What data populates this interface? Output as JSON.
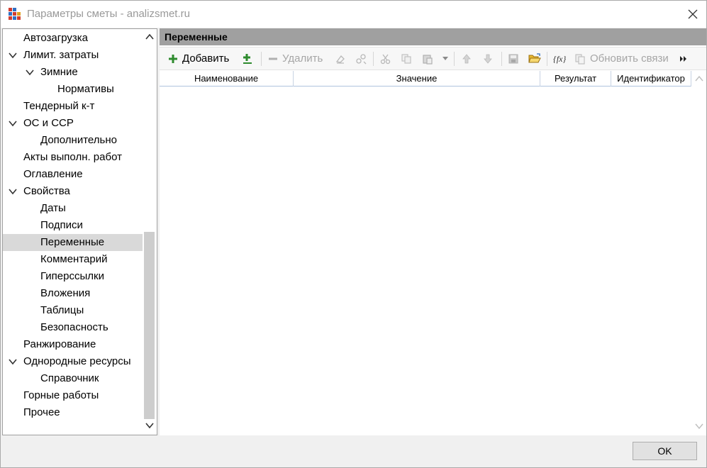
{
  "window": {
    "title": "Параметры сметы - analizsmet.ru",
    "close_icon": "close-icon",
    "app_icon": "app-grid-icon"
  },
  "tree": {
    "items": [
      {
        "label": "Автозагрузка",
        "level": 0,
        "expanded": null
      },
      {
        "label": "Лимит. затраты",
        "level": 0,
        "expanded": true
      },
      {
        "label": "Зимние",
        "level": 1,
        "expanded": true
      },
      {
        "label": "Нормативы",
        "level": 2,
        "expanded": null
      },
      {
        "label": "Тендерный к-т",
        "level": 0,
        "expanded": null
      },
      {
        "label": "ОС и ССР",
        "level": 0,
        "expanded": true
      },
      {
        "label": "Дополнительно",
        "level": 1,
        "expanded": null
      },
      {
        "label": "Акты выполн. работ",
        "level": 0,
        "expanded": null
      },
      {
        "label": "Оглавление",
        "level": 0,
        "expanded": null
      },
      {
        "label": "Свойства",
        "level": 0,
        "expanded": true
      },
      {
        "label": "Даты",
        "level": 1,
        "expanded": null
      },
      {
        "label": "Подписи",
        "level": 1,
        "expanded": null
      },
      {
        "label": "Переменные",
        "level": 1,
        "expanded": null,
        "selected": true
      },
      {
        "label": "Комментарий",
        "level": 1,
        "expanded": null
      },
      {
        "label": "Гиперссылки",
        "level": 1,
        "expanded": null
      },
      {
        "label": "Вложения",
        "level": 1,
        "expanded": null
      },
      {
        "label": "Таблицы",
        "level": 1,
        "expanded": null
      },
      {
        "label": "Безопасность",
        "level": 1,
        "expanded": null
      },
      {
        "label": "Ранжирование",
        "level": 0,
        "expanded": null
      },
      {
        "label": "Однородные ресурсы",
        "level": 0,
        "expanded": true
      },
      {
        "label": "Справочник",
        "level": 1,
        "expanded": null
      },
      {
        "label": "Горные работы",
        "level": 0,
        "expanded": null
      },
      {
        "label": "Прочее",
        "level": 0,
        "expanded": null
      }
    ]
  },
  "panel": {
    "title": "Переменные"
  },
  "toolbar": {
    "add_label": "Добавить",
    "delete_label": "Удалить",
    "refresh_label": "Обновить связи"
  },
  "grid": {
    "columns": [
      "Наименование",
      "Значение",
      "Результат",
      "Идентификатор"
    ],
    "rows": []
  },
  "footer": {
    "ok_label": "OK"
  },
  "colors": {
    "header_bar": "#a0a0a0",
    "selected_item": "#d9d9d9",
    "add_icon_green": "#2e8b2e",
    "folder_yellow": "#e8b830"
  }
}
